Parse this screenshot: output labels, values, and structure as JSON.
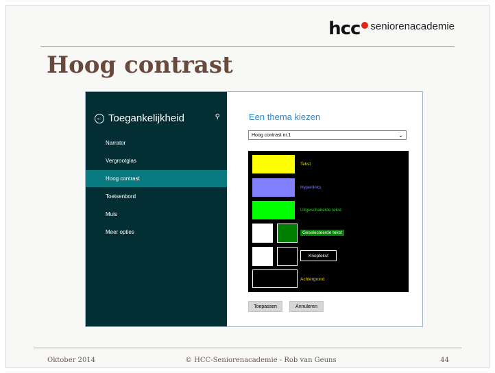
{
  "logo": {
    "brand": "hcc",
    "sub": "seniorenacademie"
  },
  "slide_title": "Hoog contrast",
  "settings": {
    "header": "Toegankelijkheid",
    "nav": [
      "Narrator",
      "Vergrootglas",
      "Hoog contrast",
      "Toetsenbord",
      "Muis",
      "Meer opties"
    ],
    "selected_nav": "Hoog contrast",
    "main_title": "Een thema kiezen",
    "theme_select": "Hoog contrast nr.1",
    "preview": {
      "text": "Tekst",
      "hyperlinks": "Hyperlinks",
      "disabled_text": "Uitgeschakelde tekst",
      "selected_text": "Geselecteerde tekst",
      "button_text": "Knoptekst",
      "background": "Achtergrond"
    },
    "colors": {
      "text": "#ffff00",
      "hyperlinks": "#8080ff",
      "disabled": "#00ff00",
      "selected": "#008000",
      "background": "#000000"
    },
    "apply_button": "Toepassen",
    "cancel_button": "Annuleren"
  },
  "footer": {
    "date": "Oktober 2014",
    "credit": "© HCC-Seniorenacademie - Rob van Geuns",
    "page": "44"
  }
}
